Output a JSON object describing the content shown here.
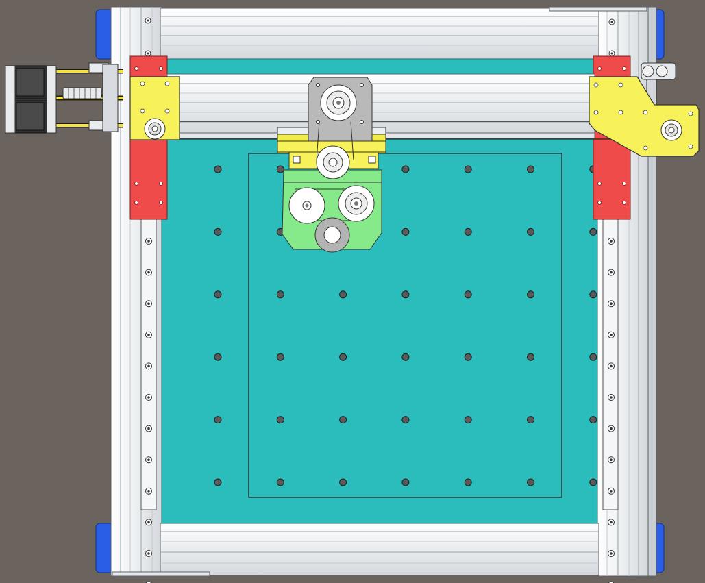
{
  "scene": {
    "subject": "cnc-router-top-view",
    "colors": {
      "background": "#6b635e",
      "bed": "#2bbcbc",
      "extrusion": "#f1f3f4",
      "extrusion_line": "#9aa0a6",
      "red_plate": "#ef4b4b",
      "yellow_plate": "#f7f25a",
      "green_plate": "#86e98a",
      "blue_foot": "#2a5ee6",
      "gray_plate": "#b9b9b9",
      "motor_dark": "#303030",
      "hole_fill": "#5a5a5a"
    },
    "bed_hole_grid": {
      "rows": 6,
      "cols": 7
    },
    "side_rail_holes": 12,
    "stepper_motors": 2
  }
}
